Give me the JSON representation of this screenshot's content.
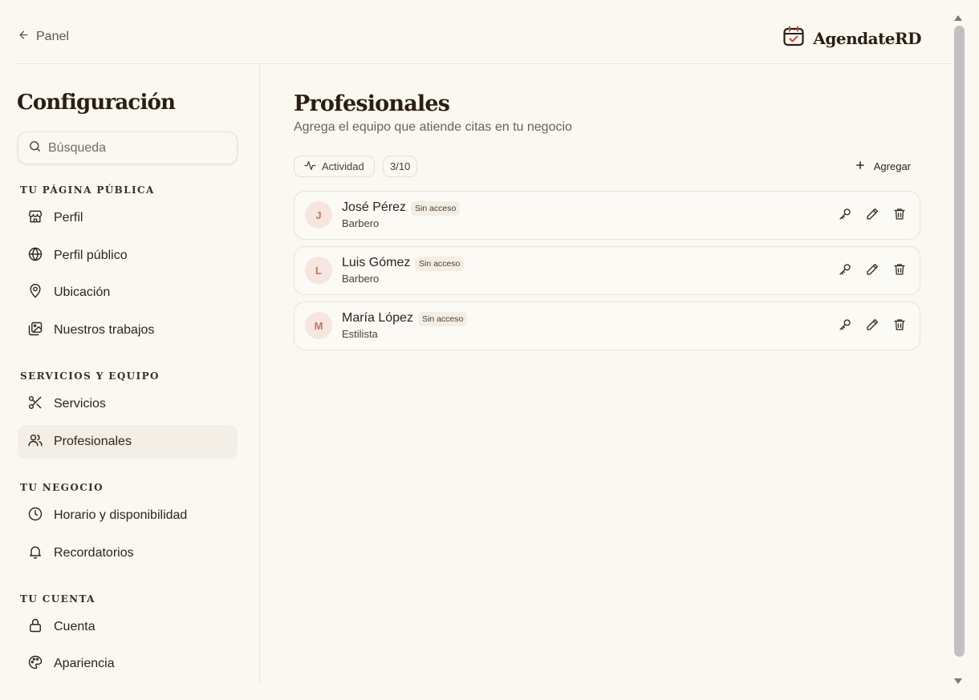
{
  "header": {
    "back_label": "Panel",
    "brand_name": "AgendateRD"
  },
  "sidebar": {
    "title": "Configuración",
    "search_placeholder": "Búsqueda",
    "sections": {
      "public_page": {
        "label": "Tu página pública",
        "items": [
          {
            "label": "Perfil",
            "icon": "store-icon"
          },
          {
            "label": "Perfil público",
            "icon": "globe-icon"
          },
          {
            "label": "Ubicación",
            "icon": "map-pin-icon"
          },
          {
            "label": "Nuestros trabajos",
            "icon": "images-icon"
          }
        ]
      },
      "services_team": {
        "label": "Servicios y equipo",
        "items": [
          {
            "label": "Servicios",
            "icon": "scissors-icon"
          },
          {
            "label": "Profesionales",
            "icon": "users-icon",
            "active": true
          }
        ]
      },
      "business": {
        "label": "Tu negocio",
        "items": [
          {
            "label": "Horario y disponibilidad",
            "icon": "clock-icon"
          },
          {
            "label": "Recordatorios",
            "icon": "bell-icon"
          }
        ]
      },
      "account": {
        "label": "Tu cuenta",
        "items": [
          {
            "label": "Cuenta",
            "icon": "lock-icon"
          },
          {
            "label": "Apariencia",
            "icon": "palette-icon"
          }
        ]
      }
    }
  },
  "main": {
    "title": "Profesionales",
    "subtitle": "Agrega el equipo que atiende citas en tu negocio",
    "activity_label": "Actividad",
    "count_label": "3/10",
    "add_label": "Agregar",
    "professionals": [
      {
        "initial": "J",
        "name": "José Pérez",
        "badge": "Sin acceso",
        "role": "Barbero"
      },
      {
        "initial": "L",
        "name": "Luis Gómez",
        "badge": "Sin acceso",
        "role": "Barbero"
      },
      {
        "initial": "M",
        "name": "María López",
        "badge": "Sin acceso",
        "role": "Estilista"
      }
    ]
  },
  "colors": {
    "background": "#fbf8f2",
    "active_nav": "#f4efe6",
    "avatar_bg": "#f6e6df",
    "avatar_text": "#c07663",
    "brand_accent": "#c2563f"
  }
}
